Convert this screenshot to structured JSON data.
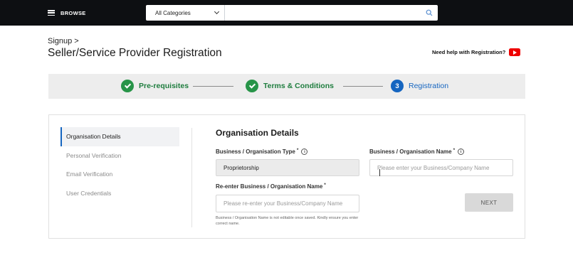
{
  "header": {
    "browse_label": "BROWSE",
    "category_selected": "All Categories",
    "search_placeholder": ""
  },
  "page": {
    "breadcrumb": "Signup >",
    "title": "Seller/Service Provider Registration",
    "help_text": "Need help with Registration?"
  },
  "stepper": {
    "steps": [
      {
        "label": "Pre-requisites",
        "status": "done"
      },
      {
        "label": "Terms & Conditions",
        "status": "done"
      },
      {
        "label": "Registration",
        "number": "3",
        "status": "active"
      }
    ]
  },
  "sidebar": {
    "items": [
      {
        "label": "Organisation Details",
        "active": true
      },
      {
        "label": "Personal Verification",
        "active": false
      },
      {
        "label": "Email Verification",
        "active": false
      },
      {
        "label": "User Credentials",
        "active": false
      }
    ]
  },
  "form": {
    "title": "Organisation Details",
    "type_label": "Business / Organisation Type",
    "type_value": "Proprietorship",
    "name_label": "Business / Organisation Name",
    "name_placeholder": "Please enter your Business/Company Name",
    "reenter_label": "Re-enter Business / Organisation Name",
    "reenter_placeholder": "Please re-enter your Business/Company Name",
    "required_mark": "*",
    "info_glyph": "i",
    "note": "Business / Organisation Name is not editable once saved. Kindly ensure you enter correct name.",
    "next_label": "NEXT"
  },
  "colors": {
    "topbar": "#0d0f12",
    "success": "#279448",
    "accent": "#1565c0",
    "youtube": "#e00000"
  }
}
